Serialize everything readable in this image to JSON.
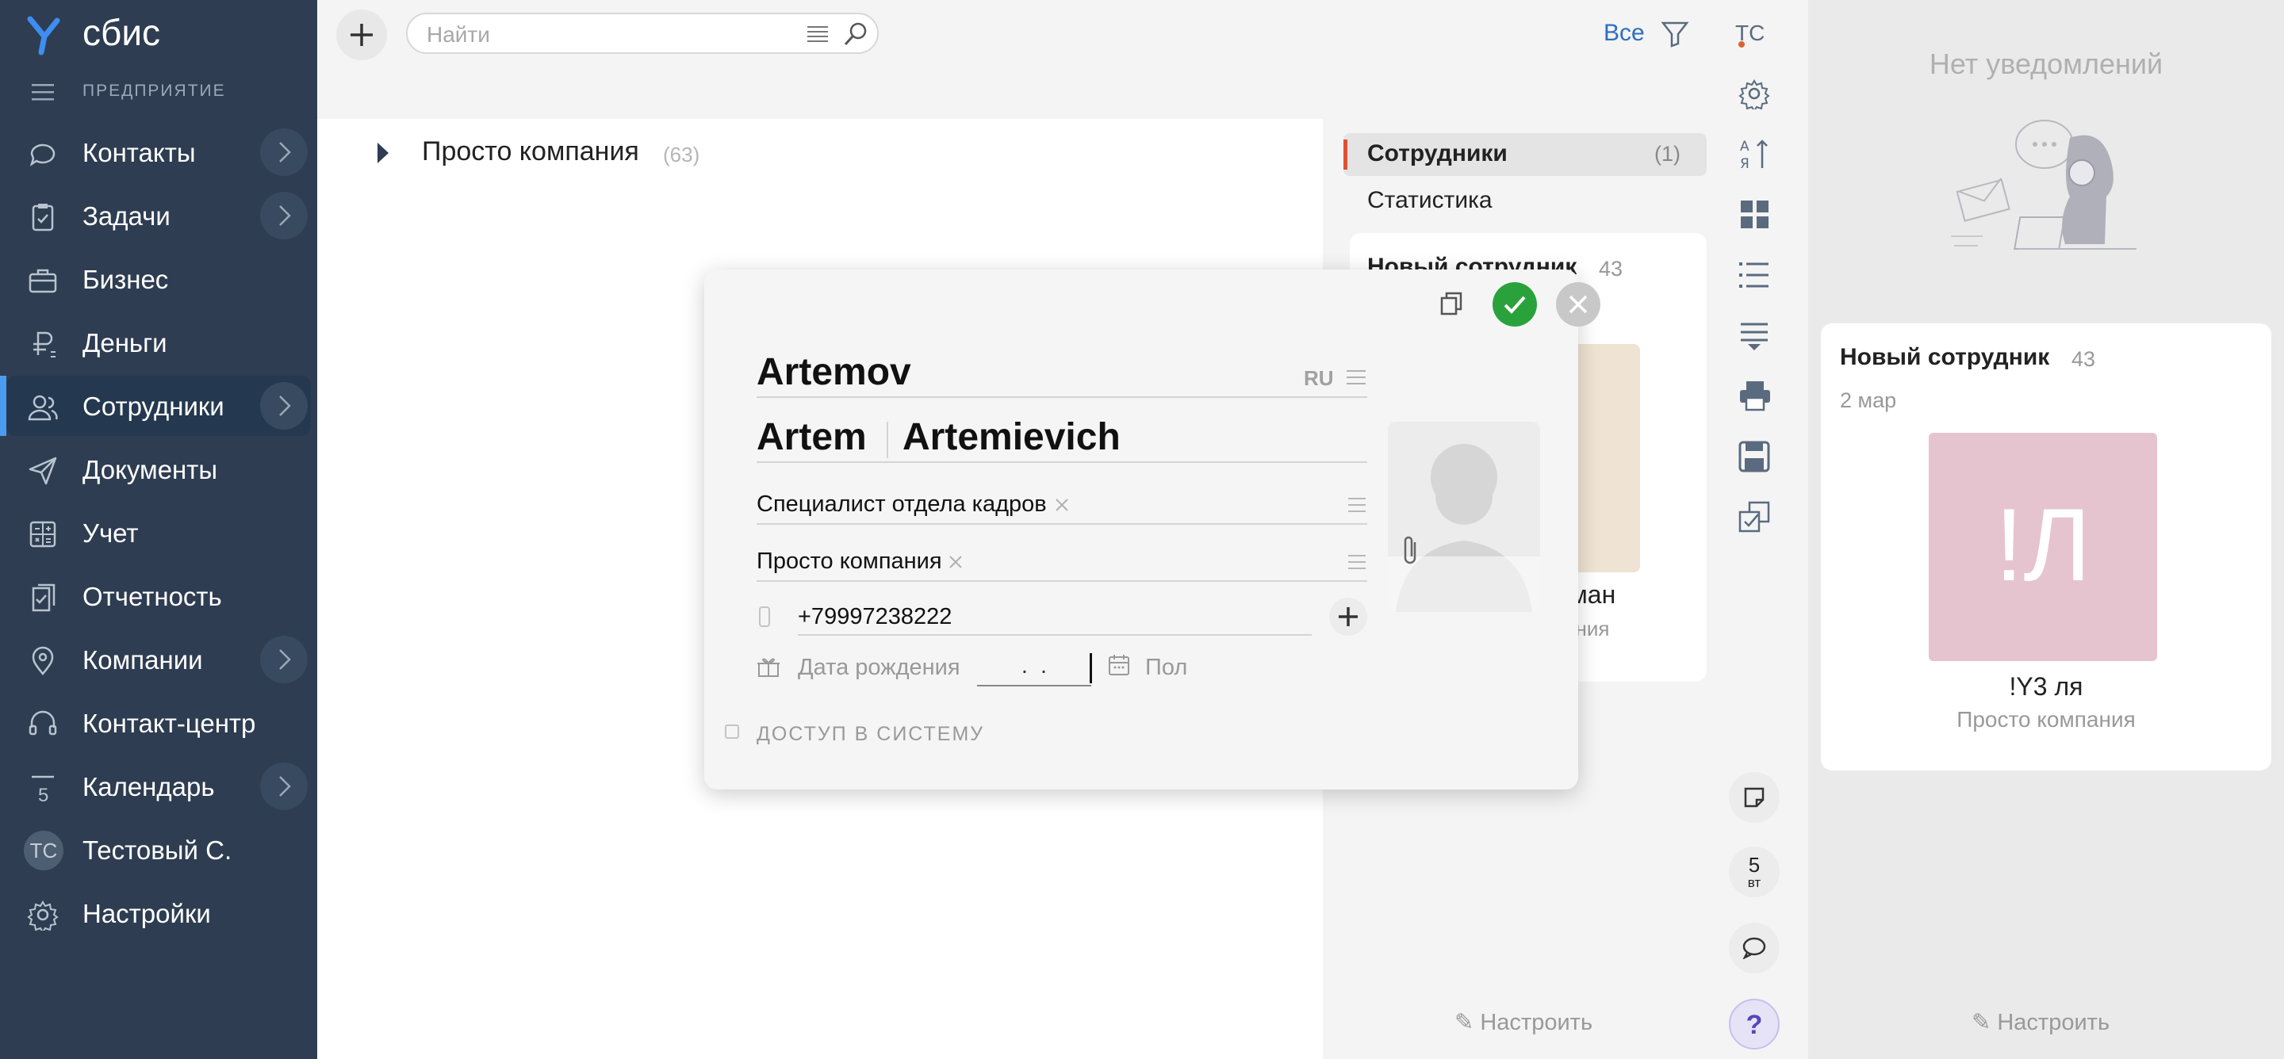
{
  "app": {
    "logo_text": "сбис",
    "section_title": "ПРЕДПРИЯТИЕ"
  },
  "sidebar": {
    "items": [
      {
        "label": "Контакты",
        "icon": "chat-icon",
        "has_arrow": true
      },
      {
        "label": "Задачи",
        "icon": "clipboard-icon",
        "has_arrow": true
      },
      {
        "label": "Бизнес",
        "icon": "briefcase-icon",
        "has_arrow": false
      },
      {
        "label": "Деньги",
        "icon": "ruble-icon",
        "has_arrow": false
      },
      {
        "label": "Сотрудники",
        "icon": "people-icon",
        "has_arrow": true,
        "active": true
      },
      {
        "label": "Документы",
        "icon": "paper-plane-icon",
        "has_arrow": false
      },
      {
        "label": "Учет",
        "icon": "calculator-icon",
        "has_arrow": false
      },
      {
        "label": "Отчетность",
        "icon": "report-icon",
        "has_arrow": false
      },
      {
        "label": "Компании",
        "icon": "map-pin-icon",
        "has_arrow": true
      },
      {
        "label": "Контакт-центр",
        "icon": "headset-icon",
        "has_arrow": false
      },
      {
        "label": "Календарь",
        "icon": "calendar-icon",
        "has_arrow": true,
        "badge": "5"
      },
      {
        "label": "Тестовый С.",
        "icon": "avatar",
        "has_arrow": false,
        "avatar": "ТС"
      },
      {
        "label": "Настройки",
        "icon": "gear-icon",
        "has_arrow": false
      }
    ]
  },
  "toolbar": {
    "search_placeholder": "Найти",
    "filter_label": "Все",
    "user_initials": "ТС"
  },
  "tree": {
    "name": "Просто компания",
    "count": "(63)"
  },
  "tabs": [
    {
      "label": "Сотрудники",
      "count": "(1)",
      "active": true
    },
    {
      "label": "Статистика",
      "count": "",
      "active": false
    }
  ],
  "bg_card": {
    "title": "Новый сотрудник",
    "count": "43",
    "name_fragment": "оман",
    "company_fragment": "ания"
  },
  "modal": {
    "last_name": "Artemov",
    "lang": "RU",
    "first_name": "Artem",
    "patronymic": "Artemievich",
    "position": "Специалист отдела кадров",
    "company": "Просто компания",
    "phone": "+79997238222",
    "birth_placeholder": "Дата рождения",
    "birth_value": " .  . ",
    "gender_label": "Пол",
    "access_label": "ДОСТУП В СИСТЕМУ"
  },
  "rail": {
    "day_number": "5",
    "day_name": "вт",
    "help": "?"
  },
  "bottom": {
    "configure": "Настроить"
  },
  "notifications": {
    "empty_title": "Нет уведомлений",
    "card_title": "Новый сотрудник",
    "card_count": "43",
    "card_date": "2 мар",
    "tile_text": "!Л",
    "person_name": "!Y3 ля",
    "person_company": "Просто компания",
    "tile_color": "#e6c4cf"
  },
  "colors": {
    "sidebar": "#2e3d51",
    "accent_blue": "#4a9cf0",
    "confirm_green": "#2aa23c",
    "active_tab_marker": "#e05030"
  }
}
